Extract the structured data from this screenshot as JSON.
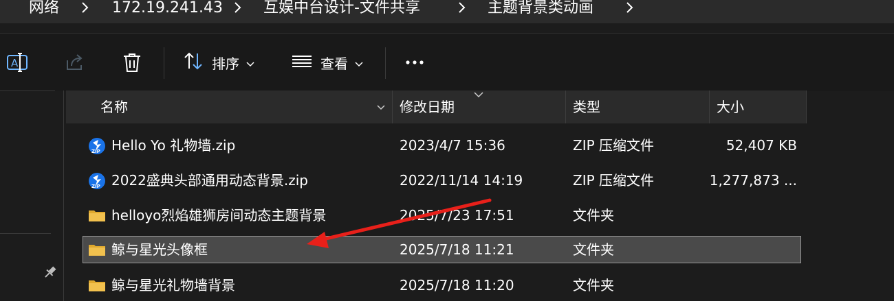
{
  "breadcrumb": {
    "items": [
      "网络",
      "172.19.241.43",
      "互娱中台设计-文件共享",
      "主题背景类动画"
    ]
  },
  "toolbar": {
    "sort_label": "排序",
    "view_label": "查看"
  },
  "columns": {
    "name": "名称",
    "date": "修改日期",
    "type": "类型",
    "size": "大小"
  },
  "files": [
    {
      "name": "Hello Yo 礼物墙.zip",
      "date": "2023/4/7 15:36",
      "type": "ZIP 压缩文件",
      "size": "52,407 KB",
      "icon": "zip-icon"
    },
    {
      "name": "2022盛典头部通用动态背景.zip",
      "date": "2022/11/14 14:19",
      "type": "ZIP 压缩文件",
      "size": "1,277,873 ...",
      "icon": "zip-icon"
    },
    {
      "name": "helloyo烈焰雄狮房间动态主题背景",
      "date": "2025/7/23 17:51",
      "type": "文件夹",
      "size": "",
      "icon": "folder-icon"
    },
    {
      "name": "鲸与星光头像框",
      "date": "2025/7/18 11:21",
      "type": "文件夹",
      "size": "",
      "icon": "folder-icon",
      "selected": true
    },
    {
      "name": "鲸与星光礼物墙背景",
      "date": "2025/7/18 11:20",
      "type": "文件夹",
      "size": "",
      "icon": "folder-icon"
    }
  ],
  "colors": {
    "background": "#1c1c1c",
    "header": "#2b2b2b",
    "selection": "#4a4a4a",
    "folder": "#f2c14e",
    "zip_badge": "#1a73e8",
    "annotation_arrow": "#e8201a"
  }
}
